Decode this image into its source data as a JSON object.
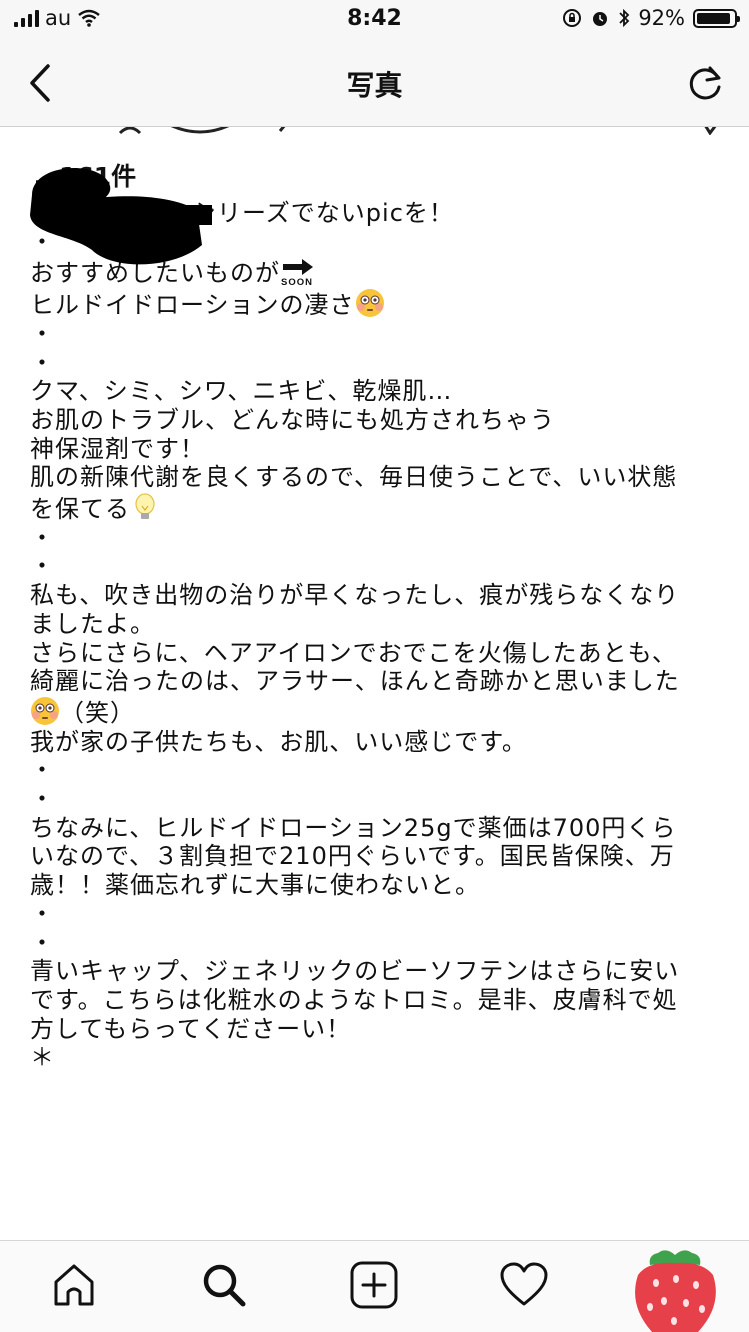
{
  "status_bar": {
    "carrier": "au",
    "time": "8:42",
    "battery": "92%",
    "battery_level": 0.92
  },
  "nav": {
    "title": "写真"
  },
  "post": {
    "likes": "…161件",
    "caption": {
      "l1": "シリーズでないpicを！",
      "l2": "・",
      "l3": "おすすめしたいものが",
      "l4": "ヒルドイドローションの凄さ",
      "l5": "・",
      "l6": "・",
      "l7": "クマ、シミ、シワ、ニキビ、乾燥肌…",
      "l8": "お肌のトラブル、どんな時にも処方されちゃう",
      "l9": "神保湿剤です！",
      "l10": "肌の新陳代謝を良くするので、毎日使うことで、いい状態",
      "l11": "を保てる",
      "l12": "・",
      "l13": "・",
      "l14": "私も、吹き出物の治りが早くなったし、痕が残らなくなり",
      "l15": "ましたよ。",
      "l16": "さらにさらに、ヘアアイロンでおでこを火傷したあとも、",
      "l17": "綺麗に治ったのは、アラサー、ほんと奇跡かと思いました",
      "l18": "（笑）",
      "l19": "我が家の子供たちも、お肌、いい感じです。",
      "l20": "・",
      "l21": "・",
      "l22": "ちなみに、ヒルドイドローション25gで薬価は700円くら",
      "l23": "いなので、３割負担で210円ぐらいです。国民皆保険、万",
      "l24": "歳！！薬価忘れずに大事に使わないと。",
      "l25": "・",
      "l26": "・",
      "l27": "青いキャップ、ジェネリックのビーソフテンはさらに安い",
      "l28": "です。こちらは化粧水のようなトロミ。是非、皮膚科で処",
      "l29": "方してもらってくださーい！",
      "l30": "＊"
    },
    "soon_label": "SOON"
  },
  "icons": {
    "back": "chevron-left-icon",
    "refresh": "refresh-icon",
    "home": "home-icon",
    "search": "search-icon",
    "add": "add-post-icon",
    "activity": "heart-icon",
    "profile": "profile-avatar"
  }
}
